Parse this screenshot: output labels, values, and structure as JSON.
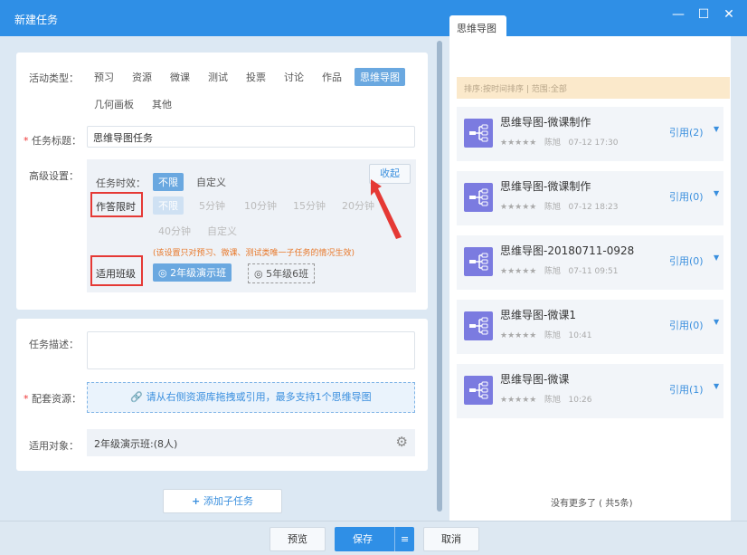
{
  "window": {
    "title": "新建任务",
    "minimize": "—",
    "maximize": "☐",
    "close": "✕"
  },
  "form": {
    "activity_type_label": "活动类型：",
    "activity_types": [
      "预习",
      "资源",
      "微课",
      "测试",
      "投票",
      "讨论",
      "作品",
      "思维导图",
      "几何画板",
      "其他"
    ],
    "selected_type": "思维导图",
    "title_label": "任务标题：",
    "title_value": "思维导图任务",
    "advanced_label": "高级设置：",
    "time_label": "任务时效：",
    "time_options": [
      "不限",
      "自定义"
    ],
    "collapse": "收起",
    "answer_limit_label": "作答限时",
    "answer_limit_options": [
      "不限",
      "5分钟",
      "10分钟",
      "15分钟",
      "20分钟",
      "40分钟",
      "自定义"
    ],
    "note": "(该设置只对预习、微课、测试类唯一子任务的情况生效)",
    "class_label": "适用班级",
    "classes": [
      "2年级演示班",
      "5年级6班"
    ],
    "desc_label": "任务描述：",
    "desc_value": "",
    "resource_label": "配套资源：",
    "resource_placeholder": "请从右侧资源库拖拽或引用，最多支持1个思维导图",
    "target_label": "适用对象：",
    "target_value": "2年级演示班:(8人)",
    "add_subtask": "添加子任务"
  },
  "footer": {
    "preview": "预览",
    "save": "保存",
    "cancel": "取消"
  },
  "right": {
    "tab": "思维导图",
    "filter": "排序:按时间排序 | 范围:全部",
    "items": [
      {
        "name": "思维导图-微课制作",
        "stars": "★★★★★",
        "author": "陈旭",
        "time": "07-12 17:30",
        "ref": "引用(2)"
      },
      {
        "name": "思维导图-微课制作",
        "stars": "★★★★★",
        "author": "陈旭",
        "time": "07-12 18:23",
        "ref": "引用(0)"
      },
      {
        "name": "思维导图-20180711-0928",
        "stars": "★★★★★",
        "author": "陈旭",
        "time": "07-11 09:51",
        "ref": "引用(0)"
      },
      {
        "name": "思维导图-微课1",
        "stars": "★★★★★",
        "author": "陈旭",
        "time": "10:41",
        "ref": "引用(0)"
      },
      {
        "name": "思维导图-微课",
        "stars": "★★★★★",
        "author": "陈旭",
        "time": "10:26",
        "ref": "引用(1)"
      }
    ],
    "end_text": "没有更多了 ( 共5条)"
  },
  "colors": {
    "primary": "#2f8fe6",
    "accent": "#6aa8e0",
    "note": "#e8782a",
    "highlight": "#e53935"
  }
}
